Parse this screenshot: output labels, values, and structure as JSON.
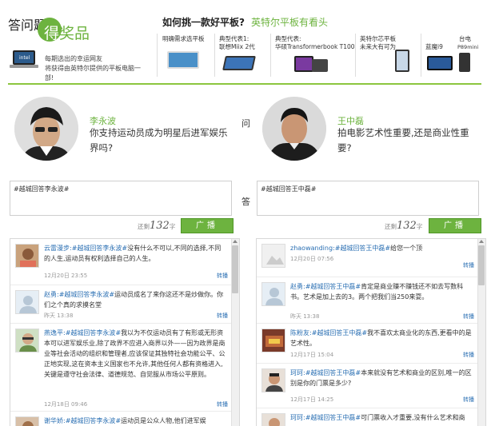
{
  "header": {
    "title_part1": "答问题",
    "title_part2a": "得",
    "title_part2b": "奖品",
    "desc_line1": "每期选出的幸运网友",
    "desc_line2": "将获得由英特尔提供的平板电脑一部!",
    "laptop_logo": "intel",
    "question": "如何挑一款好平板?",
    "question_sub": "英特尔平板有看头",
    "products": [
      {
        "line1": "明确需求选平板",
        "line2": ""
      },
      {
        "line1": "典型代表1:",
        "line2": "联想Miix 2代"
      },
      {
        "line1": "典型代表:",
        "line2": "华硕Transformerbook T100"
      },
      {
        "line1": "英特尔芯平板",
        "line2": "未来大有可为"
      },
      {
        "line1": "蓝魔i9",
        "line2": ""
      },
      {
        "line1": "台电",
        "line2": "P89mini"
      }
    ]
  },
  "left": {
    "name": "李永波",
    "question": "你支持运动员成为明星后进军娱乐界吗?",
    "draft": "#越城回答李永波#",
    "counter_prefix": "还剩",
    "counter_value": "132",
    "counter_suffix": "字",
    "post_label": "广播",
    "feed": [
      {
        "user": "云雷漫步:",
        "tag": "#越城回答李永波#",
        "text": "没有什么不可以,不同的选择,不同的人生,运动员有权利选择自己的人生。",
        "time": "12月20日 23:55",
        "forward": "转播"
      },
      {
        "user": "赵勇:",
        "tag": "#越城回答李永波#",
        "text": "运动员成名了来你这还不是炒做你。你们之个真的求摸名堂",
        "time": "昨天 13:38",
        "forward": "转播"
      },
      {
        "user": "燕逸平:",
        "tag": "#越城回答李永波#",
        "text": "我以为不仅运动员有了有形或无形资本可以进军娱乐业,除了政界不应进入商界以外——因为政界是商业等社会活动的组织和管理者,应该保证其独特社会功能公平、公正地实现,这在资本主义国家也不允许,其他任何人都有资格进入,关键是遵守社会法律、道德规范、自觉服从市场公平原则。",
        "time": "12月18日 09:46",
        "forward": "转播"
      },
      {
        "user": "谢华娇:",
        "tag": "#越城回答李永波#",
        "text": "运动员是公众人物,他们进军娱",
        "time": "",
        "forward": ""
      }
    ]
  },
  "right": {
    "name": "王中磊",
    "question": "拍电影艺术性重要,还是商业性重要?",
    "draft": "#越城回答王中磊#",
    "counter_prefix": "还剩",
    "counter_value": "132",
    "counter_suffix": "字",
    "post_label": "广播",
    "feed": [
      {
        "user": "zhaowanding:",
        "tag": "#越城回答王中磊#",
        "text": "给您一个顶",
        "time": "12月20日 07:56",
        "forward": "转播"
      },
      {
        "user": "赵勇:",
        "tag": "#越城回答王中磊#",
        "text": "肯定是商业赚不赚钱还不如去写数科书。艺术是加上去的3。两个把我们当250来耍。",
        "time": "昨天 13:38",
        "forward": "转播"
      },
      {
        "user": "陈粉友:",
        "tag": "#越城回答王中磊#",
        "text": "我不喜欢太商业化的东西,更看中的是艺术性。",
        "time": "12月17日 15:04",
        "forward": "转播"
      },
      {
        "user": "珂珂:",
        "tag": "#越城回答王中磊#",
        "text": "本来就没有艺术和商业的区别,唯一的区别是你的门票是多少?",
        "time": "12月17日 14:25",
        "forward": "转播"
      },
      {
        "user": "珂珂:",
        "tag": "#越城回答王中磊#",
        "text": "可门票收入才重要,没有什么艺术和商",
        "time": "",
        "forward": ""
      }
    ]
  },
  "mid": {
    "ask": "问",
    "answer": "答"
  },
  "colors": {
    "accent": "#6db33f",
    "link": "#2a6fb3"
  }
}
